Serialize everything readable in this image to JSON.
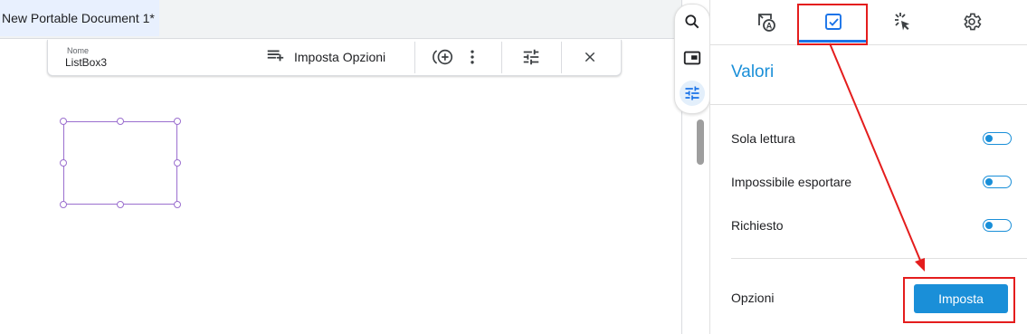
{
  "tabs": {
    "active_document_title": "New Portable Document 1*"
  },
  "field_toolbar": {
    "name_caption": "Nome",
    "field_name": "ListBox3",
    "set_options_label": "Imposta Opzioni",
    "icons": [
      "add-option-icon",
      "more-vert-icon",
      "field-properties-icon",
      "close-icon"
    ]
  },
  "rail": {
    "buttons": [
      "search-icon",
      "thumbnails-icon",
      "field-properties-icon"
    ],
    "active": "field-properties-icon"
  },
  "panel": {
    "tabs": [
      "field-appearance-icon",
      "values-icon",
      "actions-icon",
      "settings-icon"
    ],
    "active_tab": "values-icon",
    "title": "Valori",
    "properties": [
      {
        "label": "Sola lettura",
        "enabled": false
      },
      {
        "label": "Impossibile esportare",
        "enabled": false
      },
      {
        "label": "Richiesto",
        "enabled": false
      }
    ],
    "options_label": "Opzioni",
    "options_button": "Imposta"
  },
  "colors": {
    "accent": "#1a8fd8",
    "selection": "#9b6fcf",
    "annotation": "#e41d1d"
  }
}
